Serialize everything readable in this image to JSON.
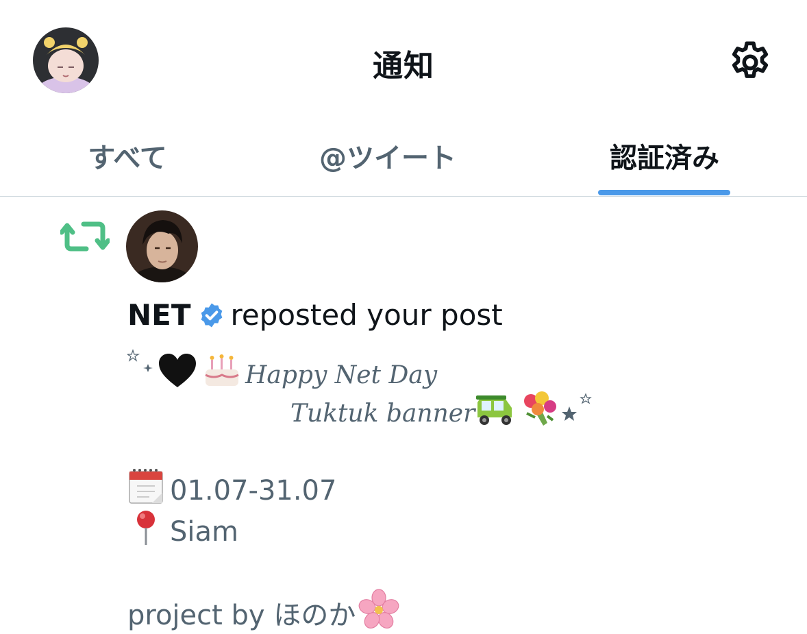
{
  "header": {
    "title": "通知"
  },
  "tabs": [
    {
      "label": "すべて",
      "active": false
    },
    {
      "label": "@ツイート",
      "active": false
    },
    {
      "label": "認証済み",
      "active": true
    }
  ],
  "notification": {
    "type": "repost",
    "user_name": "NET",
    "action_text": "reposted your post",
    "verified": true,
    "post": {
      "line1_text": "Happy Net Day",
      "line2_text": "Tuktuk banner",
      "date_text": "01.07-31.07",
      "location_text": "Siam",
      "credit_text": "project by ほのか"
    }
  },
  "colors": {
    "accent": "#4a99e9",
    "retweet_green": "#4fbf86",
    "secondary_text": "#536471",
    "primary_text": "#0f1419",
    "divider": "#cfd9de"
  },
  "icons": [
    "avatar",
    "gear-icon",
    "repost-icon",
    "verified-badge-icon",
    "sparkle-icon",
    "black-heart-icon",
    "birthday-cake-icon",
    "auto-rickshaw-icon",
    "bouquet-icon",
    "star-icon",
    "calendar-icon",
    "pushpin-icon",
    "cherry-blossom-icon"
  ]
}
